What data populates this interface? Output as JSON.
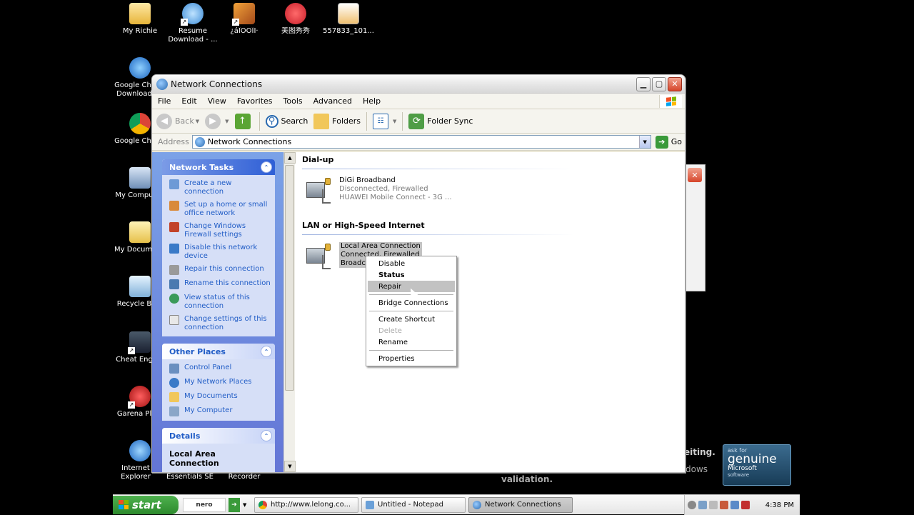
{
  "desktop": {
    "icons": [
      {
        "label": "My Richie"
      },
      {
        "label": "Resume Download - ..."
      },
      {
        "label": "¿áÎÒÓÎÏ·"
      },
      {
        "label": "美图秀秀"
      },
      {
        "label": "557833_101..."
      },
      {
        "label": "Google Chr Download"
      },
      {
        "label": "Google Chr"
      },
      {
        "label": "My Compu"
      },
      {
        "label": "My Docume"
      },
      {
        "label": "Recycle B"
      },
      {
        "label": "Cheat Eng"
      },
      {
        "label": "Garena Pl"
      },
      {
        "label": "Internet Explorer"
      },
      {
        "label": "Essentials SE"
      },
      {
        "label": "Recorder"
      }
    ],
    "genuine_text_1": "eiting.",
    "genuine_text_2": "dows",
    "genuine_text_3": "validation.",
    "genuine_badge": {
      "ask": "ask for",
      "big": "genuine",
      "ms": "Microsoft",
      "sw": "software"
    }
  },
  "window": {
    "title": "Network Connections",
    "menu": [
      "File",
      "Edit",
      "View",
      "Favorites",
      "Tools",
      "Advanced",
      "Help"
    ],
    "toolbar": {
      "back": "Back",
      "search": "Search",
      "folders": "Folders",
      "folder_sync": "Folder Sync"
    },
    "address": {
      "label": "Address",
      "value": "Network Connections",
      "go": "Go"
    }
  },
  "taskpane": {
    "network_tasks": {
      "title": "Network Tasks",
      "items": [
        "Create a new connection",
        "Set up a home or small office network",
        "Change Windows Firewall settings",
        "Disable this network device",
        "Repair this connection",
        "Rename this connection",
        "View status of this connection",
        "Change settings of this connection"
      ]
    },
    "other_places": {
      "title": "Other Places",
      "items": [
        "Control Panel",
        "My Network Places",
        "My Documents",
        "My Computer"
      ]
    },
    "details": {
      "title": "Details",
      "value": "Local Area Connection"
    }
  },
  "groups": {
    "dialup": {
      "title": "Dial-up",
      "name": "DiGi Broadband",
      "status": "Disconnected, Firewalled",
      "device": "HUAWEI Mobile Connect - 3G ..."
    },
    "lan": {
      "title": "LAN or High-Speed Internet",
      "name": "Local Area Connection",
      "status": "Connected, Firewalled",
      "device": "Broadco"
    }
  },
  "context_menu": {
    "items": [
      {
        "label": "Disable"
      },
      {
        "label": "Status"
      },
      {
        "label": "Repair"
      },
      {
        "label": "Bridge Connections"
      },
      {
        "label": "Create Shortcut"
      },
      {
        "label": "Delete"
      },
      {
        "label": "Rename"
      },
      {
        "label": "Properties"
      }
    ]
  },
  "taskbar": {
    "start": "start",
    "quick_launch": "nero",
    "tasks": [
      "http://www.lelong.co...",
      "Untitled - Notepad",
      "Network Connections"
    ],
    "clock": "4:38 PM"
  }
}
